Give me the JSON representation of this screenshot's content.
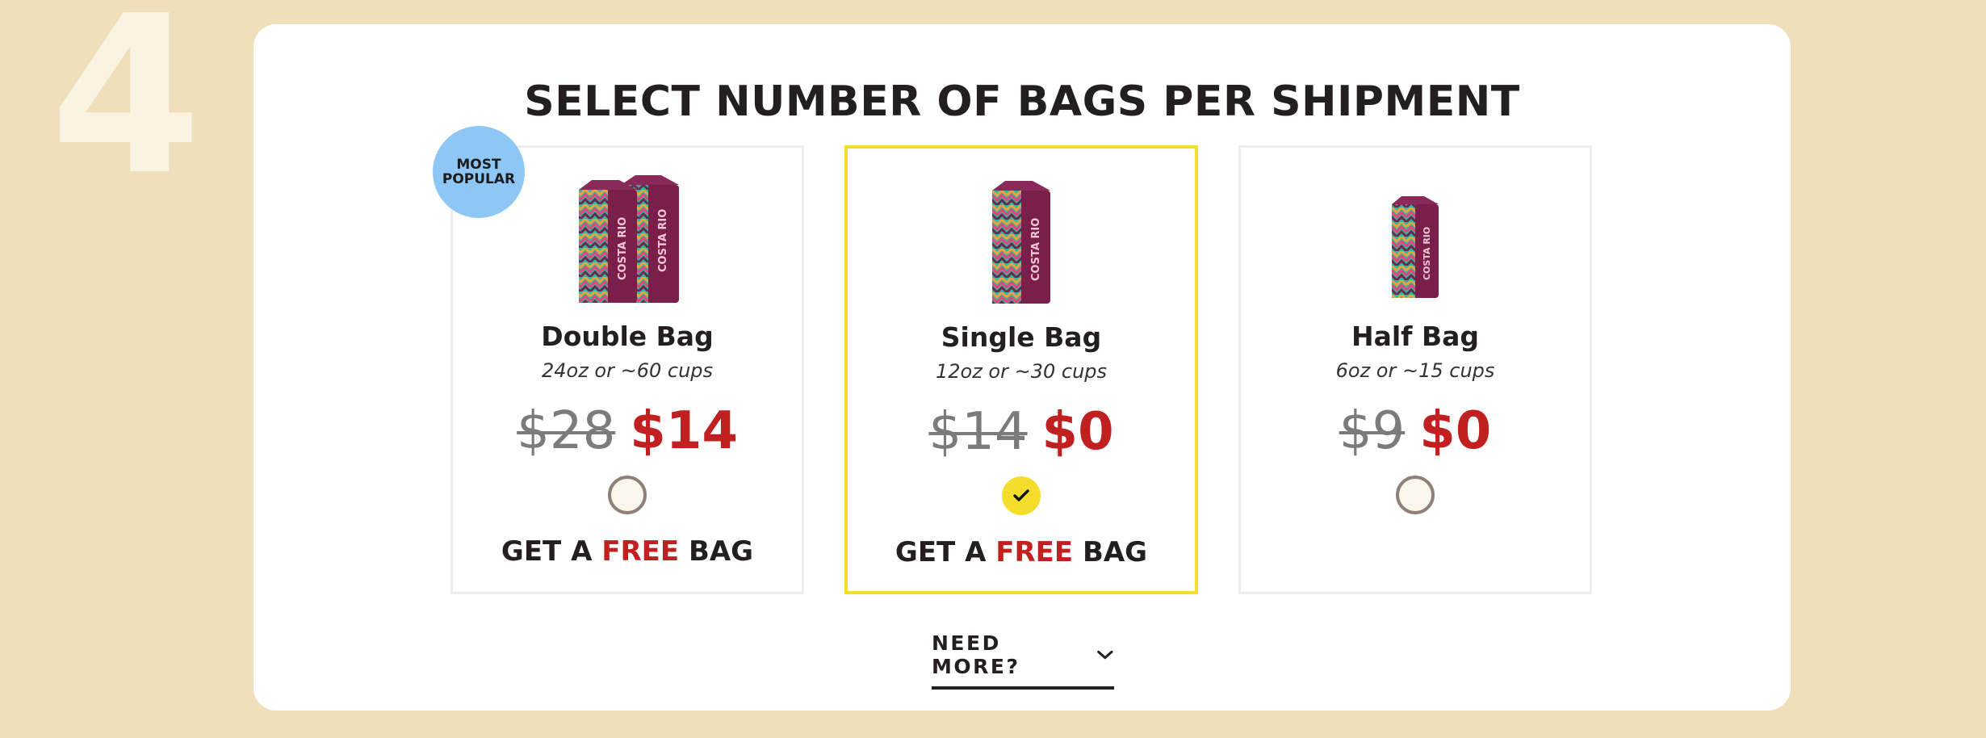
{
  "step": {
    "number": "4"
  },
  "heading": "SELECT NUMBER OF BAGS PER SHIPMENT",
  "badge": {
    "line1": "MOST",
    "line2": "POPULAR"
  },
  "options": [
    {
      "title": "Double Bag",
      "subtitle": "24oz or ~60 cups",
      "old_price": "$28",
      "new_price": "$14",
      "selected": false,
      "promo": {
        "pre": "GET A",
        "free": "FREE",
        "post": "BAG"
      },
      "bag_brand": "COSTA RIO"
    },
    {
      "title": "Single Bag",
      "subtitle": "12oz or ~30 cups",
      "old_price": "$14",
      "new_price": "$0",
      "selected": true,
      "promo": {
        "pre": "GET A",
        "free": "FREE",
        "post": "BAG"
      },
      "bag_brand": "COSTA RIO"
    },
    {
      "title": "Half Bag",
      "subtitle": "6oz or ~15 cups",
      "old_price": "$9",
      "new_price": "$0",
      "selected": false,
      "bag_brand": "COSTA RIO"
    }
  ],
  "need_more": {
    "label": "NEED MORE?",
    "icon": "chevron-down-icon"
  },
  "colors": {
    "background": "#efe0bb",
    "accent_yellow": "#f5dd2c",
    "price_red": "#c0201f",
    "badge_blue": "#8ec7f5"
  }
}
